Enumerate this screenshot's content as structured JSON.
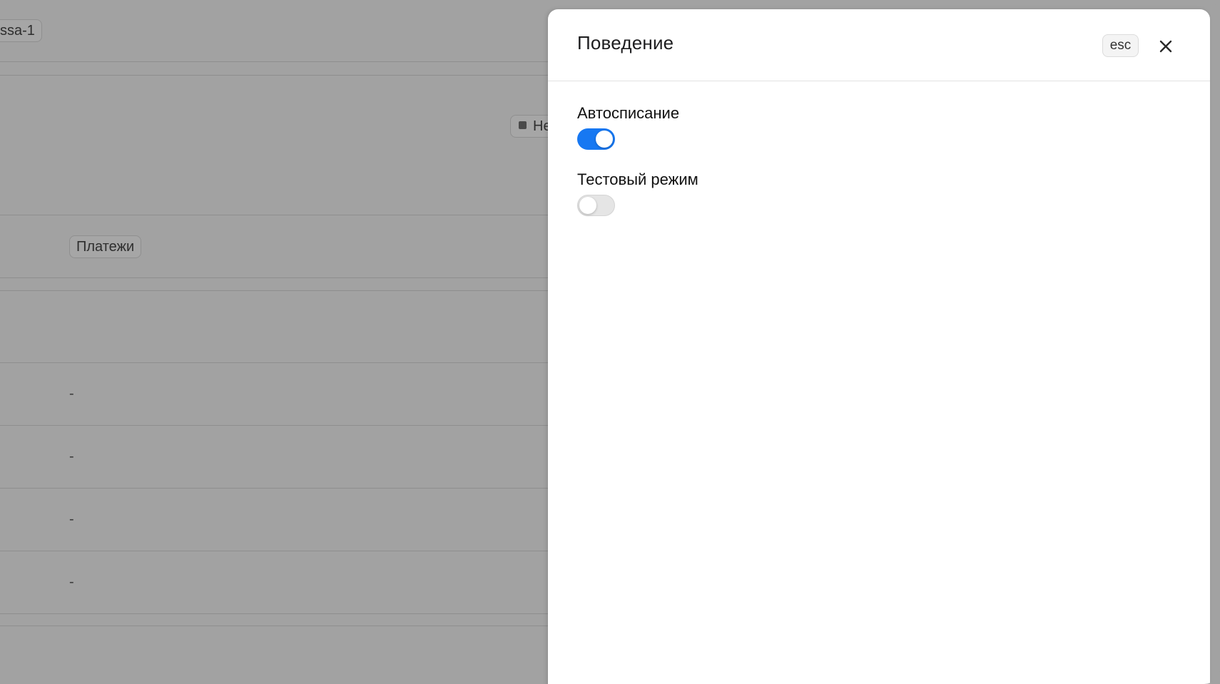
{
  "background": {
    "top_chip": "ssa-1",
    "status_chip": "Не",
    "payments_chip": "Платежи",
    "rows": [
      "-",
      "-",
      "-",
      "-"
    ]
  },
  "panel": {
    "title": "Поведение",
    "esc_label": "esc",
    "settings": [
      {
        "label": "Автосписание",
        "enabled": true
      },
      {
        "label": "Тестовый режим",
        "enabled": false
      }
    ]
  },
  "colors": {
    "toggle_on": "#1778f2",
    "toggle_off": "#e5e5e5",
    "overlay": "#a2a2a2"
  },
  "icons": {
    "close": "close-icon"
  }
}
